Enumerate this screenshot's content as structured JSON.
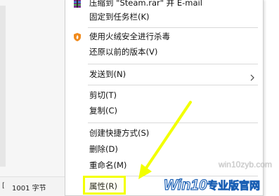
{
  "explorer": {
    "status_left": "[",
    "file_size": "1001 字节"
  },
  "menu": {
    "items": [
      {
        "label": "压缩到 \"Steam.rar\" 并 E-mail",
        "icon": "rar-archive-icon"
      },
      {
        "label": "固定到任务栏(K)"
      },
      {
        "label": "使用火绒安全进行杀毒",
        "icon": "huorong-shield-icon"
      },
      {
        "label": "还原以前的版本(V)"
      },
      {
        "label": "发送到(N)",
        "submenu": true
      },
      {
        "label": "剪切(T)"
      },
      {
        "label": "复制(C)"
      },
      {
        "label": "创建快捷方式(S)"
      },
      {
        "label": "删除(D)"
      },
      {
        "label": "重命名(M)"
      },
      {
        "label": "属性(R)",
        "highlighted": true
      }
    ]
  },
  "watermark": {
    "url": "win10zyb.com",
    "brand_latin": "Win10",
    "brand_cn": "专业版官网"
  },
  "colors": {
    "highlight": "#f4ff00",
    "arrow": "#f2ff00",
    "menu_border": "#cfcfcf",
    "separator": "#d9d9d9",
    "huorong_orange": "#f08a1c"
  }
}
